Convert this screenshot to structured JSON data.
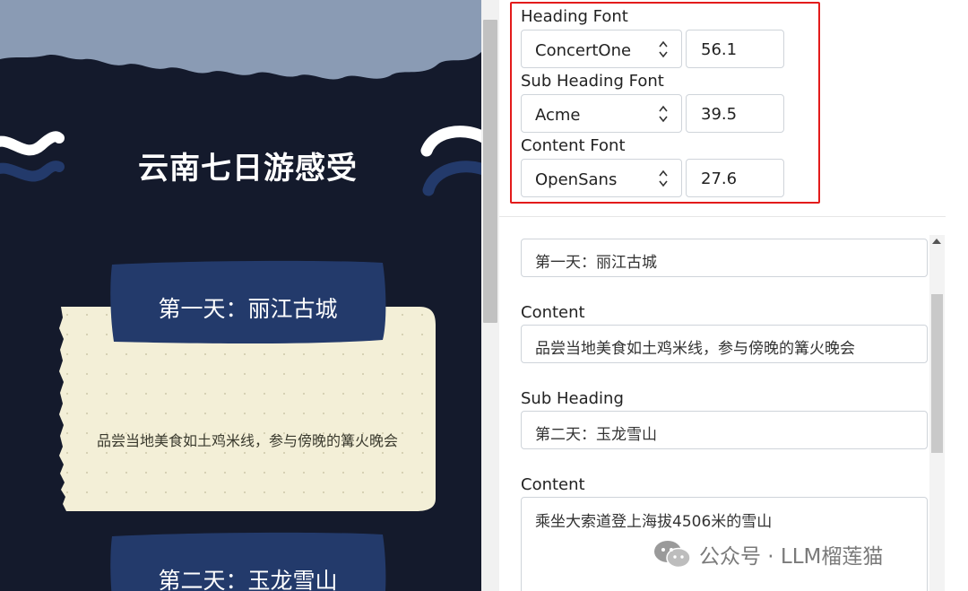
{
  "preview": {
    "title": "云南七日游感受",
    "cards": [
      {
        "sub_heading": "第一天：丽江古城",
        "content": "品尝当地美食如土鸡米线，参与傍晚的篝火晚会"
      },
      {
        "sub_heading": "第二天：玉龙雪山"
      }
    ],
    "colors": {
      "background": "#141a2c",
      "cloud": "#8a9bb4",
      "banner": "#233a6b",
      "paper": "#f3efd7"
    }
  },
  "font_settings": {
    "heading": {
      "label": "Heading Font",
      "font": "ConcertOne",
      "size": "56.1"
    },
    "sub_heading": {
      "label": "Sub Heading Font",
      "font": "Acme",
      "size": "39.5"
    },
    "content": {
      "label": "Content Font",
      "font": "OpenSans",
      "size": "27.6"
    }
  },
  "sections": {
    "field1_value": "第一天：丽江古城",
    "field2_label": "Content",
    "field2_value": "品尝当地美食如土鸡米线，参与傍晚的篝火晚会",
    "field3_label": "Sub Heading",
    "field3_value": "第二天：玉龙雪山",
    "field4_label": "Content",
    "field4_value": "乘坐大索道登上海拔4506米的雪山"
  },
  "watermark": {
    "text": "公众号 · LLM榴莲猫"
  },
  "highlight_color": "#e31b1b"
}
